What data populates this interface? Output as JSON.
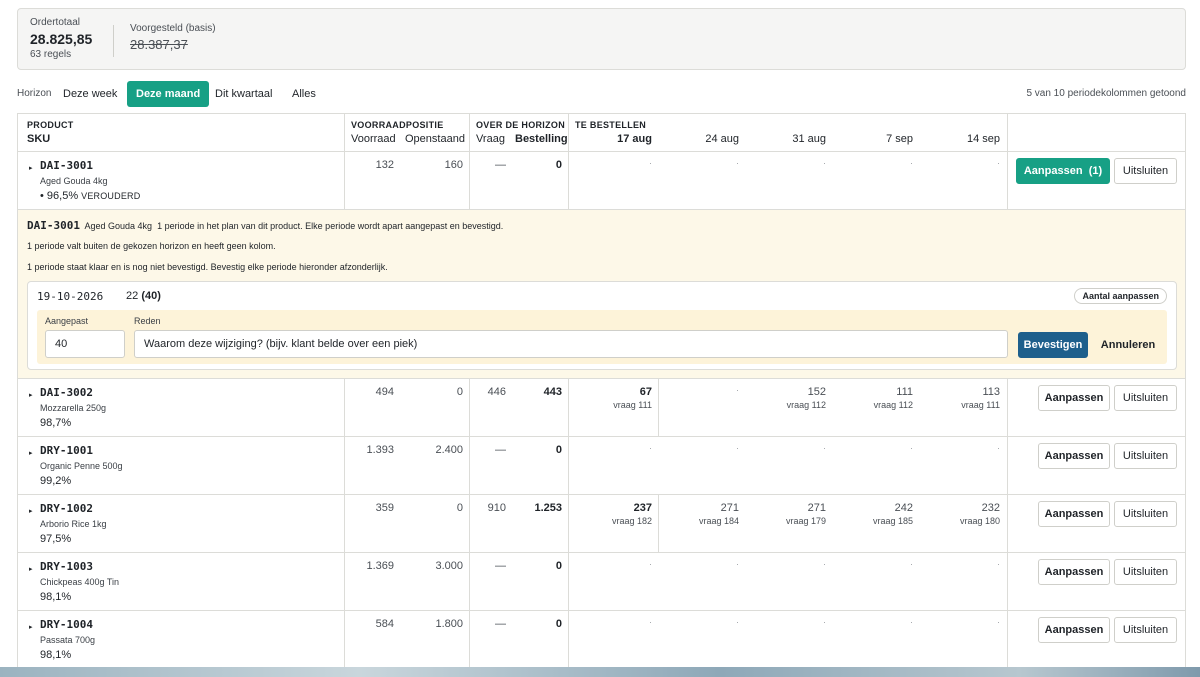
{
  "summary": {
    "order_total_label": "Ordertotaal",
    "order_total_value": "28.825,85",
    "order_total_sub": "63 regels",
    "suggested_label": "Voorgesteld (basis)",
    "suggested_value": "28.387,37"
  },
  "horizon": {
    "label": "Horizon",
    "tabs": [
      "Deze week",
      "Deze maand",
      "Dit kwartaal",
      "Alles"
    ],
    "active": "Deze maand",
    "right_text": "5 van 10 periodekolommen getoond"
  },
  "header": {
    "product_top": "PRODUCT",
    "product_bot": "SKU",
    "stock_top": "VOORRAADPOSITIE",
    "stock_a": "Voorraad",
    "stock_b": "Openstaand",
    "horizon_top": "OVER DE HORIZON",
    "horizon_a": "Vraag",
    "horizon_b": "Bestelling",
    "order_top": "TE BESTELLEN",
    "periods": [
      "17 aug",
      "24 aug",
      "31 aug",
      "7 sep",
      "14 sep"
    ]
  },
  "rows": [
    {
      "sku": "DAI-3001",
      "name": "Aged Gouda 4kg",
      "pct": "96,5%",
      "badge": "VEROUDERD",
      "stock": "132",
      "open": "160",
      "demand": "—",
      "order": "0",
      "periods": [
        {
          "v": "·"
        },
        {
          "v": "·"
        },
        {
          "v": "·"
        },
        {
          "v": "·"
        },
        {
          "v": "·"
        }
      ],
      "adjust": "Aanpassen",
      "adjust_count": "(1)",
      "exclude": "Uitsluiten"
    },
    {
      "sku": "DAI-3002",
      "name": "Mozzarella 250g",
      "pct": "98,7%",
      "stock": "494",
      "open": "0",
      "demand": "446",
      "order": "443",
      "periods": [
        {
          "v": "67",
          "sub": "vraag 111"
        },
        {
          "v": "·"
        },
        {
          "v": "152",
          "sub": "vraag 112"
        },
        {
          "v": "111",
          "sub": "vraag 112"
        },
        {
          "v": "113",
          "sub": "vraag 111"
        }
      ],
      "adjust": "Aanpassen",
      "exclude": "Uitsluiten"
    },
    {
      "sku": "DRY-1001",
      "name": "Organic Penne 500g",
      "pct": "99,2%",
      "stock": "1.393",
      "open": "2.400",
      "demand": "—",
      "order": "0",
      "periods": [
        {
          "v": "·"
        },
        {
          "v": "·"
        },
        {
          "v": "·"
        },
        {
          "v": "·"
        },
        {
          "v": "·"
        }
      ],
      "adjust": "Aanpassen",
      "exclude": "Uitsluiten"
    },
    {
      "sku": "DRY-1002",
      "name": "Arborio Rice 1kg",
      "pct": "97,5%",
      "stock": "359",
      "open": "0",
      "demand": "910",
      "order": "1.253",
      "periods": [
        {
          "v": "237",
          "sub": "vraag 182"
        },
        {
          "v": "271",
          "sub": "vraag 184"
        },
        {
          "v": "271",
          "sub": "vraag 179"
        },
        {
          "v": "242",
          "sub": "vraag 185"
        },
        {
          "v": "232",
          "sub": "vraag 180"
        }
      ],
      "adjust": "Aanpassen",
      "exclude": "Uitsluiten"
    },
    {
      "sku": "DRY-1003",
      "name": "Chickpeas 400g Tin",
      "pct": "98,1%",
      "stock": "1.369",
      "open": "3.000",
      "demand": "—",
      "order": "0",
      "periods": [
        {
          "v": "·"
        },
        {
          "v": "·"
        },
        {
          "v": "·"
        },
        {
          "v": "·"
        },
        {
          "v": "·"
        }
      ],
      "adjust": "Aanpassen",
      "exclude": "Uitsluiten"
    },
    {
      "sku": "DRY-1004",
      "name": "Passata 700g",
      "pct": "98,1%",
      "stock": "584",
      "open": "1.800",
      "demand": "—",
      "order": "0",
      "periods": [
        {
          "v": "·"
        },
        {
          "v": "·"
        },
        {
          "v": "·"
        },
        {
          "v": "·"
        },
        {
          "v": "·"
        }
      ],
      "adjust": "Aanpassen",
      "exclude": "Uitsluiten"
    }
  ],
  "panel": {
    "sku": "DAI-3001",
    "name": "Aged Gouda 4kg",
    "line1": "1 periode in het plan van dit product. Elke periode wordt apart aangepast en bevestigd.",
    "line2": "1 periode valt buiten de gekozen horizon en heeft geen kolom.",
    "line3": "1 periode staat klaar en is nog niet bevestigd. Bevestig elke periode hieronder afzonderlijk.",
    "date": "19-10-2026",
    "qty": "22",
    "qty_adjusted": "(40)",
    "pill": "Aantal aanpassen",
    "adjusted_label": "Aangepast",
    "adjusted_value": "40",
    "reason_label": "Reden",
    "reason_placeholder": "Waarom deze wijziging? (bijv. klant belde over een piek)",
    "confirm": "Bevestigen",
    "cancel": "Annuleren"
  }
}
